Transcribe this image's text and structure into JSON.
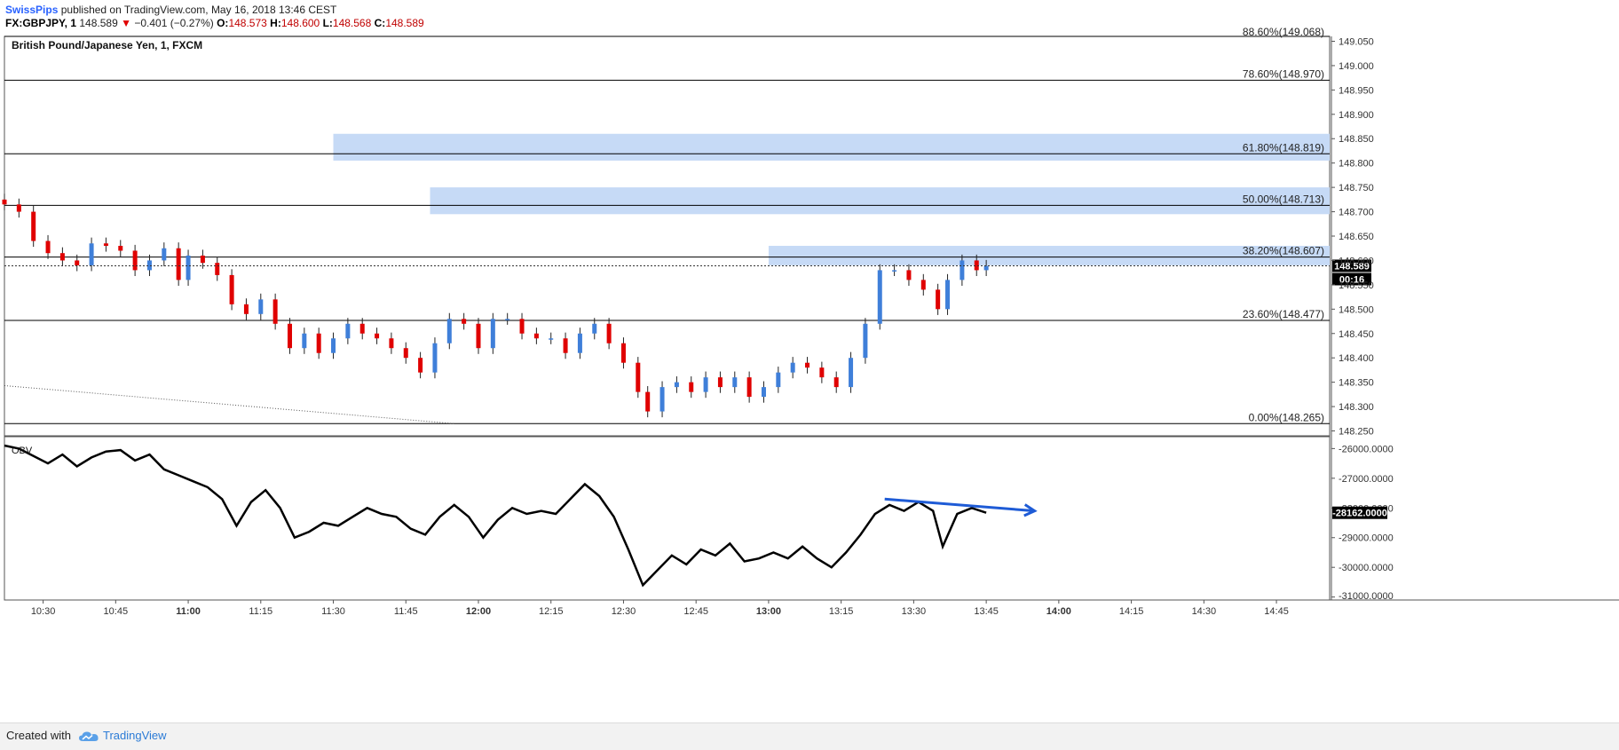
{
  "header": {
    "author": "SwissPips",
    "published": "published on TradingView.com, May 16, 2018 13:46 CEST",
    "symbol": "FX:GBPJPY, 1",
    "price": "148.589",
    "arrow": "▼",
    "change": "−0.401 (−0.27%)",
    "o_label": "O:",
    "o": "148.573",
    "h_label": "H:",
    "h": "148.600",
    "l_label": "L:",
    "l": "148.568",
    "c_label": "C:",
    "c": "148.589"
  },
  "footer": {
    "created": "Created with",
    "brand": "TradingView",
    "logo_icon": "tradingview-cloud-icon"
  },
  "chart_data": {
    "type": "candlestick",
    "title": "British Pound/Japanese Yen, 1, FXCM",
    "price_axis": {
      "range": [
        148.24,
        149.06
      ],
      "ticks": [
        "149.050",
        "149.000",
        "148.950",
        "148.900",
        "148.850",
        "148.800",
        "148.750",
        "148.700",
        "148.650",
        "148.600",
        "148.550",
        "148.500",
        "148.450",
        "148.400",
        "148.350",
        "148.300",
        "148.250"
      ],
      "last_price": "148.589",
      "countdown": "00:16"
    },
    "time_axis": {
      "start": "10:22",
      "end": "14:56",
      "ticks": [
        {
          "t": "10:30",
          "bold": false
        },
        {
          "t": "10:45",
          "bold": false
        },
        {
          "t": "11:00",
          "bold": true
        },
        {
          "t": "11:15",
          "bold": false
        },
        {
          "t": "11:30",
          "bold": false
        },
        {
          "t": "11:45",
          "bold": false
        },
        {
          "t": "12:00",
          "bold": true
        },
        {
          "t": "12:15",
          "bold": false
        },
        {
          "t": "12:30",
          "bold": false
        },
        {
          "t": "12:45",
          "bold": false
        },
        {
          "t": "13:00",
          "bold": true
        },
        {
          "t": "13:15",
          "bold": false
        },
        {
          "t": "13:30",
          "bold": false
        },
        {
          "t": "13:45",
          "bold": false
        },
        {
          "t": "14:00",
          "bold": true
        },
        {
          "t": "14:15",
          "bold": false
        },
        {
          "t": "14:30",
          "bold": false
        },
        {
          "t": "14:45",
          "bold": false
        }
      ]
    },
    "fib_levels": [
      {
        "label": "88.60%(149.068)",
        "price": 149.068
      },
      {
        "label": "78.60%(148.970)",
        "price": 148.97
      },
      {
        "label": "61.80%(148.819)",
        "price": 148.819
      },
      {
        "label": "50.00%(148.713)",
        "price": 148.713
      },
      {
        "label": "38.20%(148.607)",
        "price": 148.607
      },
      {
        "label": "23.60%(148.477)",
        "price": 148.477
      },
      {
        "label": "0.00%(148.265)",
        "price": 148.265
      }
    ],
    "zones": [
      {
        "start": "11:30",
        "low": 148.805,
        "high": 148.86
      },
      {
        "start": "11:50",
        "low": 148.695,
        "high": 148.75
      },
      {
        "start": "13:00",
        "low": 148.59,
        "high": 148.63
      }
    ],
    "trendline": {
      "from": {
        "t": "10:22",
        "p": 148.343
      },
      "to": {
        "t": "11:55",
        "p": 148.265
      }
    },
    "price_series": [
      {
        "t": "10:22",
        "p": 148.715
      },
      {
        "t": "10:25",
        "p": 148.7
      },
      {
        "t": "10:28",
        "p": 148.64
      },
      {
        "t": "10:31",
        "p": 148.615
      },
      {
        "t": "10:34",
        "p": 148.6
      },
      {
        "t": "10:37",
        "p": 148.59
      },
      {
        "t": "10:40",
        "p": 148.635
      },
      {
        "t": "10:43",
        "p": 148.63
      },
      {
        "t": "10:46",
        "p": 148.62
      },
      {
        "t": "10:49",
        "p": 148.58
      },
      {
        "t": "10:52",
        "p": 148.6
      },
      {
        "t": "10:55",
        "p": 148.625
      },
      {
        "t": "10:58",
        "p": 148.56
      },
      {
        "t": "11:00",
        "p": 148.61
      },
      {
        "t": "11:03",
        "p": 148.595
      },
      {
        "t": "11:06",
        "p": 148.57
      },
      {
        "t": "11:09",
        "p": 148.51
      },
      {
        "t": "11:12",
        "p": 148.49
      },
      {
        "t": "11:15",
        "p": 148.52
      },
      {
        "t": "11:18",
        "p": 148.47
      },
      {
        "t": "11:21",
        "p": 148.42
      },
      {
        "t": "11:24",
        "p": 148.45
      },
      {
        "t": "11:27",
        "p": 148.41
      },
      {
        "t": "11:30",
        "p": 148.44
      },
      {
        "t": "11:33",
        "p": 148.47
      },
      {
        "t": "11:36",
        "p": 148.45
      },
      {
        "t": "11:39",
        "p": 148.44
      },
      {
        "t": "11:42",
        "p": 148.42
      },
      {
        "t": "11:45",
        "p": 148.4
      },
      {
        "t": "11:48",
        "p": 148.37
      },
      {
        "t": "11:51",
        "p": 148.43
      },
      {
        "t": "11:54",
        "p": 148.48
      },
      {
        "t": "11:57",
        "p": 148.47
      },
      {
        "t": "12:00",
        "p": 148.42
      },
      {
        "t": "12:03",
        "p": 148.48
      },
      {
        "t": "12:06",
        "p": 148.48
      },
      {
        "t": "12:09",
        "p": 148.45
      },
      {
        "t": "12:12",
        "p": 148.44
      },
      {
        "t": "12:15",
        "p": 148.44
      },
      {
        "t": "12:18",
        "p": 148.41
      },
      {
        "t": "12:21",
        "p": 148.45
      },
      {
        "t": "12:24",
        "p": 148.47
      },
      {
        "t": "12:27",
        "p": 148.43
      },
      {
        "t": "12:30",
        "p": 148.39
      },
      {
        "t": "12:33",
        "p": 148.33
      },
      {
        "t": "12:35",
        "p": 148.29
      },
      {
        "t": "12:38",
        "p": 148.34
      },
      {
        "t": "12:41",
        "p": 148.35
      },
      {
        "t": "12:44",
        "p": 148.33
      },
      {
        "t": "12:47",
        "p": 148.36
      },
      {
        "t": "12:50",
        "p": 148.34
      },
      {
        "t": "12:53",
        "p": 148.36
      },
      {
        "t": "12:56",
        "p": 148.32
      },
      {
        "t": "12:59",
        "p": 148.34
      },
      {
        "t": "13:02",
        "p": 148.37
      },
      {
        "t": "13:05",
        "p": 148.39
      },
      {
        "t": "13:08",
        "p": 148.38
      },
      {
        "t": "13:11",
        "p": 148.36
      },
      {
        "t": "13:14",
        "p": 148.34
      },
      {
        "t": "13:17",
        "p": 148.4
      },
      {
        "t": "13:20",
        "p": 148.47
      },
      {
        "t": "13:23",
        "p": 148.58
      },
      {
        "t": "13:26",
        "p": 148.58
      },
      {
        "t": "13:29",
        "p": 148.56
      },
      {
        "t": "13:32",
        "p": 148.54
      },
      {
        "t": "13:35",
        "p": 148.5
      },
      {
        "t": "13:37",
        "p": 148.56
      },
      {
        "t": "13:40",
        "p": 148.6
      },
      {
        "t": "13:43",
        "p": 148.58
      },
      {
        "t": "13:45",
        "p": 148.589
      }
    ],
    "obv": {
      "label": "OBV",
      "axis_ticks": [
        "-26000.0000",
        "-27000.0000",
        "-28000.0000",
        "-29000.0000",
        "-30000.0000",
        "-31000.0000"
      ],
      "range": [
        -31100,
        -25600
      ],
      "last_value": "-28162.0000",
      "series": [
        {
          "t": "10:22",
          "v": -25900
        },
        {
          "t": "10:25",
          "v": -26000
        },
        {
          "t": "10:28",
          "v": -26250
        },
        {
          "t": "10:31",
          "v": -26500
        },
        {
          "t": "10:34",
          "v": -26200
        },
        {
          "t": "10:37",
          "v": -26600
        },
        {
          "t": "10:40",
          "v": -26300
        },
        {
          "t": "10:43",
          "v": -26100
        },
        {
          "t": "10:46",
          "v": -26050
        },
        {
          "t": "10:49",
          "v": -26400
        },
        {
          "t": "10:52",
          "v": -26200
        },
        {
          "t": "10:55",
          "v": -26700
        },
        {
          "t": "10:58",
          "v": -26900
        },
        {
          "t": "11:01",
          "v": -27100
        },
        {
          "t": "11:04",
          "v": -27300
        },
        {
          "t": "11:07",
          "v": -27700
        },
        {
          "t": "11:10",
          "v": -28600
        },
        {
          "t": "11:13",
          "v": -27800
        },
        {
          "t": "11:16",
          "v": -27400
        },
        {
          "t": "11:19",
          "v": -28000
        },
        {
          "t": "11:22",
          "v": -29000
        },
        {
          "t": "11:25",
          "v": -28800
        },
        {
          "t": "11:28",
          "v": -28500
        },
        {
          "t": "11:31",
          "v": -28600
        },
        {
          "t": "11:34",
          "v": -28300
        },
        {
          "t": "11:37",
          "v": -28000
        },
        {
          "t": "11:40",
          "v": -28200
        },
        {
          "t": "11:43",
          "v": -28300
        },
        {
          "t": "11:46",
          "v": -28700
        },
        {
          "t": "11:49",
          "v": -28900
        },
        {
          "t": "11:52",
          "v": -28300
        },
        {
          "t": "11:55",
          "v": -27900
        },
        {
          "t": "11:58",
          "v": -28300
        },
        {
          "t": "12:01",
          "v": -29000
        },
        {
          "t": "12:04",
          "v": -28400
        },
        {
          "t": "12:07",
          "v": -28000
        },
        {
          "t": "12:10",
          "v": -28200
        },
        {
          "t": "12:13",
          "v": -28100
        },
        {
          "t": "12:16",
          "v": -28200
        },
        {
          "t": "12:19",
          "v": -27700
        },
        {
          "t": "12:22",
          "v": -27200
        },
        {
          "t": "12:25",
          "v": -27600
        },
        {
          "t": "12:28",
          "v": -28300
        },
        {
          "t": "12:31",
          "v": -29400
        },
        {
          "t": "12:34",
          "v": -30600
        },
        {
          "t": "12:37",
          "v": -30100
        },
        {
          "t": "12:40",
          "v": -29600
        },
        {
          "t": "12:43",
          "v": -29900
        },
        {
          "t": "12:46",
          "v": -29400
        },
        {
          "t": "12:49",
          "v": -29600
        },
        {
          "t": "12:52",
          "v": -29200
        },
        {
          "t": "12:55",
          "v": -29800
        },
        {
          "t": "12:58",
          "v": -29700
        },
        {
          "t": "13:01",
          "v": -29500
        },
        {
          "t": "13:04",
          "v": -29700
        },
        {
          "t": "13:07",
          "v": -29300
        },
        {
          "t": "13:10",
          "v": -29700
        },
        {
          "t": "13:13",
          "v": -30000
        },
        {
          "t": "13:16",
          "v": -29500
        },
        {
          "t": "13:19",
          "v": -28900
        },
        {
          "t": "13:22",
          "v": -28200
        },
        {
          "t": "13:25",
          "v": -27900
        },
        {
          "t": "13:28",
          "v": -28100
        },
        {
          "t": "13:31",
          "v": -27800
        },
        {
          "t": "13:34",
          "v": -28100
        },
        {
          "t": "13:36",
          "v": -29300
        },
        {
          "t": "13:39",
          "v": -28200
        },
        {
          "t": "13:42",
          "v": -28000
        },
        {
          "t": "13:45",
          "v": -28162
        }
      ],
      "divergence_arrow": {
        "from": {
          "t": "13:24",
          "v": -27700
        },
        "to": {
          "t": "13:55",
          "v": -28100
        },
        "color": "#1e5bd6"
      }
    },
    "colors": {
      "up": "#3f7fd9",
      "down": "#e00000",
      "zone": "#c6daf6",
      "obv_line": "#000000",
      "price_badge": "#000000"
    }
  }
}
